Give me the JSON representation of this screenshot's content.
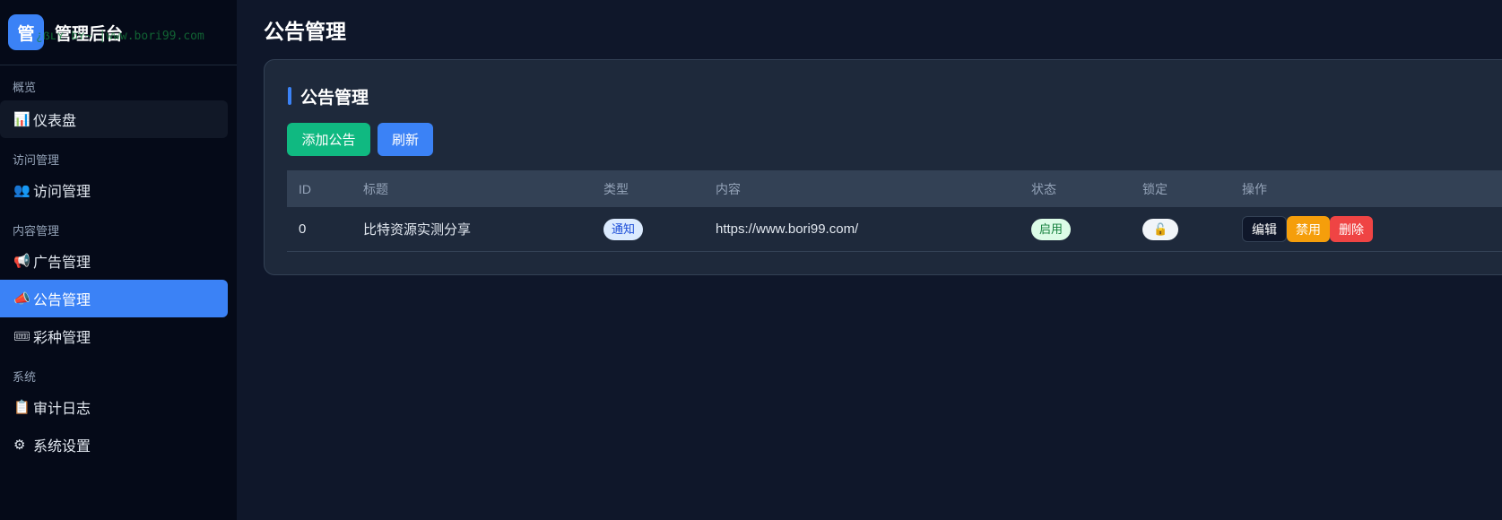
{
  "brand": {
    "logo_char": "管",
    "title": "管理后台",
    "watermark": "¿ẞʟʏ bʏ~ |www.bori99.com"
  },
  "sidebar": {
    "sections": [
      {
        "label": "概览",
        "items": [
          {
            "icon": "📊",
            "icon_name": "dashboard-icon",
            "label": "仪表盘"
          }
        ]
      },
      {
        "label": "访问管理",
        "items": [
          {
            "icon": "👥",
            "icon_name": "users-icon",
            "label": "访问管理"
          }
        ]
      },
      {
        "label": "内容管理",
        "items": [
          {
            "icon": "📢",
            "icon_name": "megaphone-icon",
            "label": "广告管理"
          },
          {
            "icon": "📣",
            "icon_name": "announcement-icon",
            "label": "公告管理"
          },
          {
            "icon": "🎟",
            "icon_name": "lottery-icon",
            "label": "彩种管理"
          }
        ]
      },
      {
        "label": "系统",
        "items": [
          {
            "icon": "📋",
            "icon_name": "clipboard-icon",
            "label": "审计日志"
          },
          {
            "icon": "⚙",
            "icon_name": "gear-icon",
            "label": "系统设置"
          }
        ]
      }
    ],
    "active_item": "公告管理"
  },
  "page": {
    "title": "公告管理",
    "card_title": "公告管理",
    "add_button": "添加公告",
    "refresh_button": "刷新"
  },
  "table": {
    "columns": [
      "ID",
      "标题",
      "类型",
      "内容",
      "状态",
      "锁定",
      "操作"
    ],
    "rows": [
      {
        "id": "0",
        "title": "比特资源实测分享",
        "type": "通知",
        "content": "https://www.bori99.com/",
        "status": "启用",
        "lock_icon": "🔓",
        "ops": {
          "edit": "编辑",
          "disable": "禁用",
          "delete": "删除"
        }
      }
    ]
  },
  "colors": {
    "accent": "#3b82f6",
    "success": "#10b981",
    "warning": "#f59e0b",
    "danger": "#ef4444"
  }
}
